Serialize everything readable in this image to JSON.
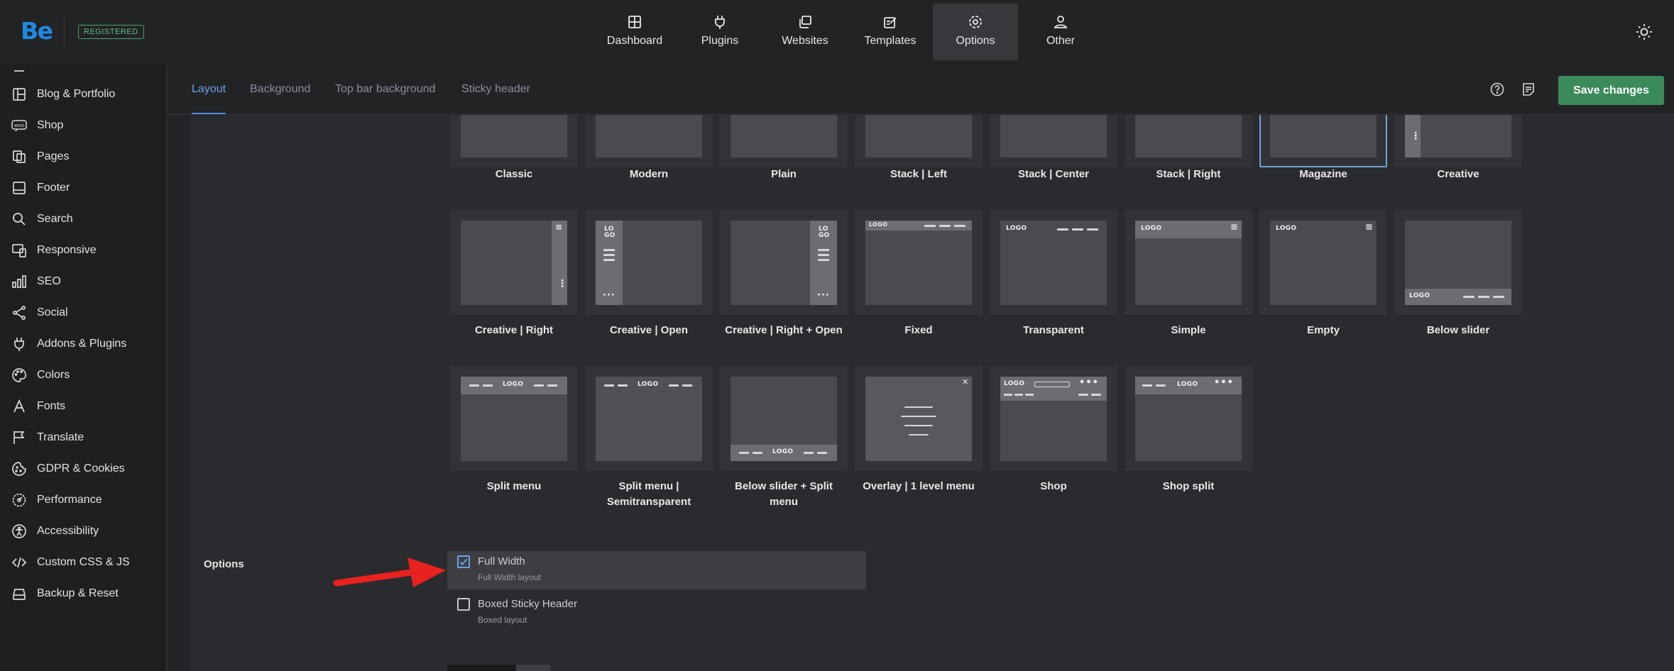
{
  "brand": {
    "logo": "Be",
    "badge": "REGISTERED",
    "accent": "#1e88e5"
  },
  "nav": [
    {
      "label": "Dashboard",
      "icon": "dashboard-icon"
    },
    {
      "label": "Plugins",
      "icon": "plug-icon"
    },
    {
      "label": "Websites",
      "icon": "websites-icon"
    },
    {
      "label": "Templates",
      "icon": "templates-icon"
    },
    {
      "label": "Options",
      "icon": "gear-icon",
      "active": true
    },
    {
      "label": "Other",
      "icon": "user-icon"
    }
  ],
  "sidebar": {
    "items": [
      {
        "label": "Blog & Portfolio",
        "icon": "layout-icon"
      },
      {
        "label": "Shop",
        "icon": "woo-icon"
      },
      {
        "label": "Pages",
        "icon": "pages-icon"
      },
      {
        "label": "Footer",
        "icon": "footer-icon"
      },
      {
        "label": "Search",
        "icon": "search-icon"
      },
      {
        "label": "Responsive",
        "icon": "responsive-icon"
      },
      {
        "label": "SEO",
        "icon": "bar-chart-icon"
      },
      {
        "label": "Social",
        "icon": "share-icon"
      },
      {
        "label": "Addons & Plugins",
        "icon": "plug-icon"
      },
      {
        "label": "Colors",
        "icon": "palette-icon"
      },
      {
        "label": "Fonts",
        "icon": "font-icon"
      },
      {
        "label": "Translate",
        "icon": "flag-icon"
      },
      {
        "label": "GDPR & Cookies",
        "icon": "cookie-icon"
      },
      {
        "label": "Performance",
        "icon": "performance-icon"
      },
      {
        "label": "Accessibility",
        "icon": "accessibility-icon"
      },
      {
        "label": "Custom CSS & JS",
        "icon": "code-icon"
      },
      {
        "label": "Backup & Reset",
        "icon": "backup-icon"
      }
    ]
  },
  "tabs": [
    {
      "label": "Layout",
      "active": true
    },
    {
      "label": "Background"
    },
    {
      "label": "Top bar background"
    },
    {
      "label": "Sticky header"
    }
  ],
  "header_actions": {
    "save_label": "Save changes",
    "save_color": "#3b8a5a"
  },
  "layouts": {
    "row1": [
      "Classic",
      "Modern",
      "Plain",
      "Stack | Left",
      "Stack | Center",
      "Stack | Right",
      "Magazine",
      "Creative"
    ],
    "row2": [
      "Creative | Right",
      "Creative | Open",
      "Creative | Right + Open",
      "Fixed",
      "Transparent",
      "Simple",
      "Empty",
      "Below slider"
    ],
    "row3": [
      "Split menu",
      "Split menu | Semitransparent",
      "Below slider + Split menu",
      "Overlay | 1 level menu",
      "Shop",
      "Shop split"
    ],
    "selected": "Magazine",
    "thumb_logo": "LOGO",
    "thumb_logo_stacked_top": "LO",
    "thumb_logo_stacked_bottom": "GO"
  },
  "options": {
    "label": "Options",
    "items": [
      {
        "title": "Full Width",
        "subtitle": "Full Width layout",
        "checked": true
      },
      {
        "title": "Boxed Sticky Header",
        "subtitle": "Boxed layout",
        "checked": false
      }
    ]
  }
}
